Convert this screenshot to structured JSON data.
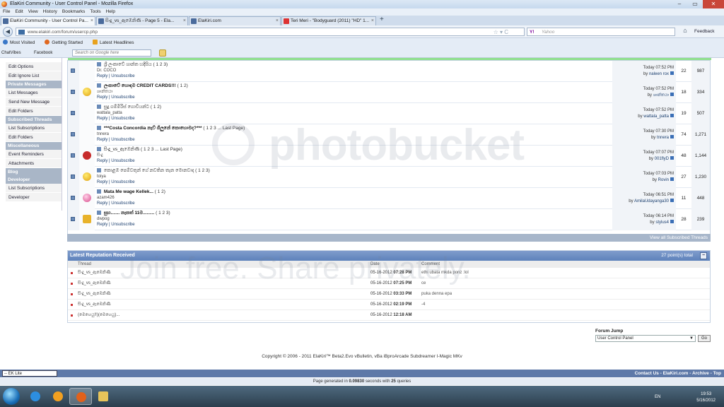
{
  "window": {
    "title": "ElaKiri Community - User Control Panel - Mozilla Firefox"
  },
  "menu": [
    "File",
    "Edit",
    "View",
    "History",
    "Bookmarks",
    "Tools",
    "Help"
  ],
  "tabs": [
    {
      "label": "ElaKiri Community - User Control Pa...",
      "close": "×"
    },
    {
      "label": "සිංදු_vs_ඇඹෙනිණි - Page 5 - Ela...",
      "close": "×"
    },
    {
      "label": "ElaKiri.com",
      "close": "×"
    },
    {
      "label": "Teri Meri - \"Bodyguard (2011) \"HD\" 1...",
      "close": "×"
    }
  ],
  "newtab": "+",
  "nav": {
    "url": "www.elakiri.com/forum/usercp.php",
    "search_placeholder": "Yahoo",
    "yahoo": "Y!",
    "feedback": "Feedback"
  },
  "bookmarks": [
    "Most Visited",
    "Getting Started",
    "Latest Headlines"
  ],
  "toolbar2": {
    "chatvibes": "ChatVibes",
    "facebook": "Facebook",
    "google_placeholder": "Search on Google here"
  },
  "sidebar": [
    {
      "type": "item",
      "label": "Edit Options"
    },
    {
      "type": "item",
      "label": "Edit Ignore List"
    },
    {
      "type": "head",
      "label": "Private Messages"
    },
    {
      "type": "item",
      "label": "List Messages"
    },
    {
      "type": "item",
      "label": "Send New Message"
    },
    {
      "type": "item",
      "label": "Edit Folders"
    },
    {
      "type": "head",
      "label": "Subscribed Threads"
    },
    {
      "type": "item",
      "label": "List Subscriptions"
    },
    {
      "type": "item",
      "label": "Edit Folders"
    },
    {
      "type": "head",
      "label": "Miscellaneous"
    },
    {
      "type": "item",
      "label": "Event Reminders"
    },
    {
      "type": "item",
      "label": "Attachments"
    },
    {
      "type": "head",
      "label": "Blog"
    },
    {
      "type": "head",
      "label": "Developer"
    },
    {
      "type": "item",
      "label": "List Subscriptions"
    },
    {
      "type": "item",
      "label": "Developer"
    }
  ],
  "threads": [
    {
      "title": "ශ්‍රී ලංකාවේ ශාන්ත හදිසිය",
      "bold": false,
      "pages": "( 1 2 3)",
      "author": "Dr. COCO",
      "reply": "Reply",
      "unsub": "Unsubscribe",
      "date": "Today 07:52 PM",
      "by": "naleen rox",
      "replies": "22",
      "views": "987",
      "emo": "none"
    },
    {
      "title": "ලංකාවේ හොඳම CREDIT CARDS!!!",
      "bold": true,
      "pages": "( 1 2)",
      "author": "ශාන්තයා",
      "reply": "Reply",
      "unsub": "Unsubscribe",
      "date": "Today 07:52 PM",
      "by": "ශාන්තයා",
      "replies": "18",
      "views": "334",
      "emo": "yellow"
    },
    {
      "title": "සුදු ගම්මිරිස් ගොවියන්ට",
      "bold": false,
      "pages": "( 1 2)",
      "author": "wattala_patta",
      "reply": "Reply",
      "unsub": "Unsubscribe",
      "date": "Today 07:52 PM",
      "by": "wattala_patta",
      "replies": "19",
      "views": "507",
      "emo": "none"
    },
    {
      "title": "***Costa Concordia නැව් ගිලුනේ කොහොමද?***",
      "bold": true,
      "pages": "( 1 2 3 ... Last Page)",
      "author": "tnnera",
      "reply": "Reply",
      "unsub": "Unsubscribe",
      "date": "Today 07:30 PM",
      "by": "tnnera",
      "replies": "74",
      "views": "1,271",
      "emo": "none"
    },
    {
      "title": "සිංදු_vs_ඇඹෙනිණි",
      "bold": false,
      "pages": "( 1 2 3 ... Last Page)",
      "author": "සිංදු",
      "reply": "Reply",
      "unsub": "Unsubscribe",
      "date": "Today 07:07 PM",
      "by": "001flyD",
      "replies": "48",
      "views": "1,144",
      "emo": "red"
    },
    {
      "title": "කොළඹ පෙම්වතුන් ගේ නවතින තැන මොනවාද",
      "bold": false,
      "pages": "( 1 2 3)",
      "author": "toiya",
      "reply": "Reply",
      "unsub": "Unsubscribe",
      "date": "Today 07:03 PM",
      "by": "Rovin",
      "replies": "27",
      "views": "1,230",
      "emo": "yellow"
    },
    {
      "title": "Mata Me wage Kellek...",
      "bold": true,
      "pages": "( 1 2)",
      "author": "azam426",
      "reply": "Reply",
      "unsub": "Unsubscribe",
      "date": "Today 06:51 PM",
      "by": "AmilaUdayanga30",
      "replies": "11",
      "views": "448",
      "emo": "pink"
    },
    {
      "title": "සුභ....... නැකත් 11ම.........",
      "bold": true,
      "pages": "( 1 2 3)",
      "author": "dwpog",
      "reply": "Reply",
      "unsub": "Unsubscribe",
      "date": "Today 06:14 PM",
      "by": "stylus4",
      "replies": "28",
      "views": "239",
      "emo": "yellowsq"
    }
  ],
  "view_all": "View all Subscribed Threads",
  "reputation": {
    "title": "Latest Reputation Received",
    "points": "27 point(s) total",
    "collapse": "−",
    "cols": {
      "thread": "Thread",
      "date": "Date",
      "comment": "Comment"
    },
    "rows": [
      {
        "thread": "සිංදු_vs_ඇඹෙනිණි",
        "date": "05-16-2012",
        "time": "07:28 PM",
        "comment": "ethi ubata mkda ponz :lol"
      },
      {
        "thread": "සිංදු_vs_ඇඹෙනිණි",
        "date": "05-16-2012",
        "time": "07:25 PM",
        "comment": "ce"
      },
      {
        "thread": "සිංදු_vs_ඇඹෙනිණි",
        "date": "05-16-2012",
        "time": "03:33 PM",
        "comment": "puka denna epa"
      },
      {
        "thread": "සිංදු_vs_ඇඹෙනිණි",
        "date": "05-16-2012",
        "time": "02:19 PM",
        "comment": "-4"
      },
      {
        "thread": "(මෙහෙයු!!)(මෙහෙයු)...",
        "date": "05-16-2012",
        "time": "12:18 AM",
        "comment": ""
      }
    ]
  },
  "forum_jump": {
    "label": "Forum Jump",
    "selected": "User Control Panel",
    "go": "Go"
  },
  "copyright": "Copyright © 2006 - 2011 ElaKiri™ Beta2.Evo vBulletin, vBa iBproArcade Subdreamer I-Magic MKv",
  "footer": {
    "style": "-- EK Lite",
    "links": "Contact Us - ElaKiri.com - Archive - Top"
  },
  "generated": {
    "prefix": "Page generated in",
    "seconds": "0.09830",
    "middle": "seconds with",
    "queries": "25",
    "suffix": "queries"
  },
  "tray": {
    "lang": "EN",
    "time": "19:53",
    "date": "5/16/2012"
  },
  "watermark": {
    "line1": "photobucket",
    "line2": "Join free. Share privately."
  }
}
